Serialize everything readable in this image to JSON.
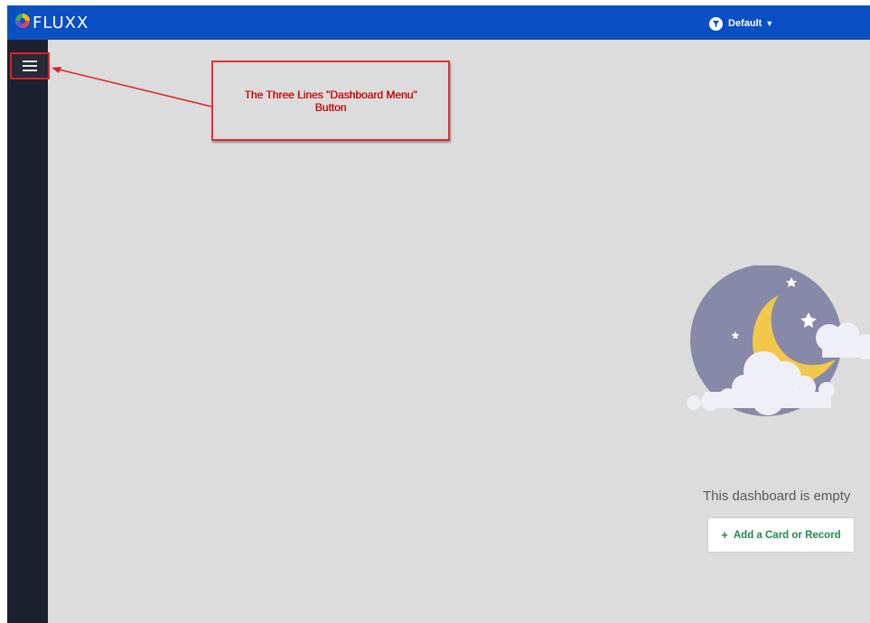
{
  "header": {
    "brand": "FLUXX",
    "filter_label": "Default",
    "filter_caret": "▼"
  },
  "sidebar": {
    "menu_icon": "hamburger-menu-icon"
  },
  "annotation": {
    "text": "The Three Lines \"Dashboard Menu\" Button"
  },
  "main": {
    "empty_message": "This dashboard is empty",
    "add_button_label": "Add a Card or Record",
    "add_button_icon": "+"
  },
  "colors": {
    "topbar": "#0a4fc4",
    "sidebar": "#1c2130",
    "background": "#dcdcdc",
    "annotation_red": "#e02020",
    "add_button_text": "#1f8a4c"
  }
}
